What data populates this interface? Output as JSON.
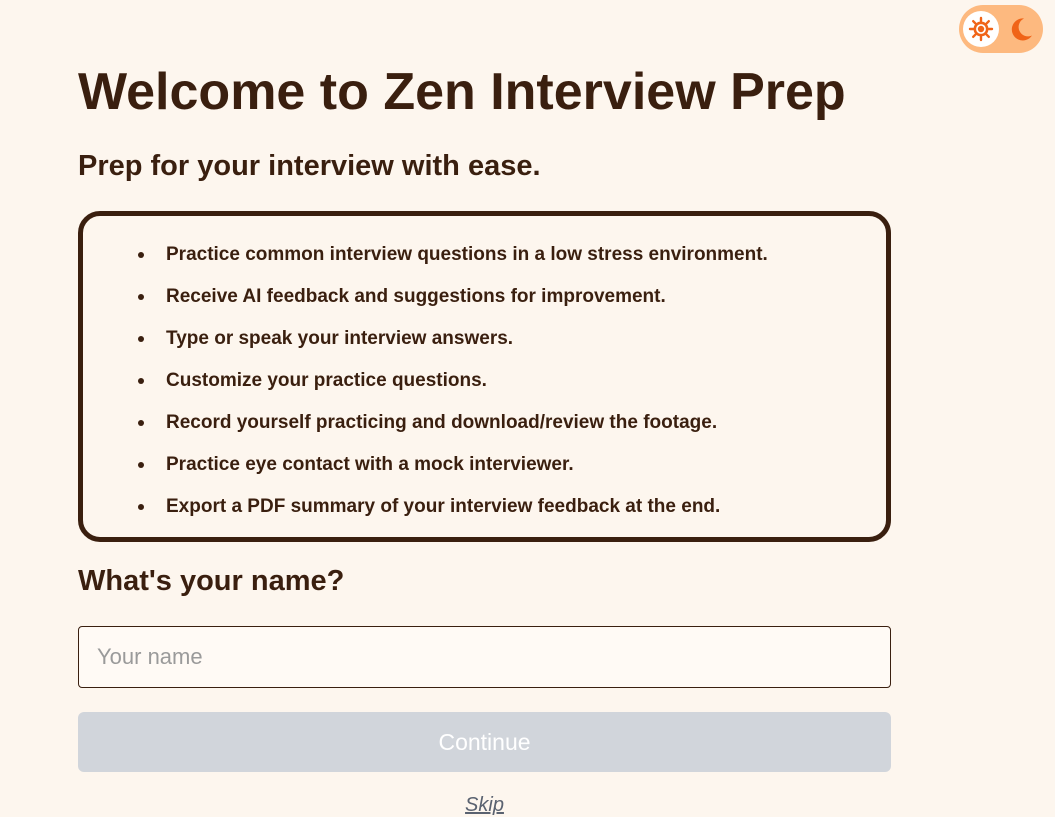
{
  "theme_toggle": {
    "sun_icon": "sun-icon",
    "moon_icon": "moon-icon",
    "active": "light",
    "track_color": "#fdb97f",
    "icon_color": "#f06418"
  },
  "header": {
    "title": "Welcome to Zen Interview Prep",
    "subtitle": "Prep for your interview with ease."
  },
  "features": {
    "items": [
      "Practice common interview questions in a low stress environment.",
      "Receive AI feedback and suggestions for improvement.",
      "Type or speak your interview answers.",
      "Customize your practice questions.",
      "Record yourself practicing and download/review the footage.",
      "Practice eye contact with a mock interviewer.",
      "Export a PDF summary of your interview feedback at the end."
    ]
  },
  "form": {
    "question": "What's your name?",
    "name_placeholder": "Your name",
    "name_value": "",
    "continue_label": "Continue",
    "continue_enabled": false,
    "skip_label": "Skip"
  },
  "colors": {
    "background": "#fdf6ee",
    "text": "#3a1f0f",
    "button_disabled": "#d1d5db"
  }
}
